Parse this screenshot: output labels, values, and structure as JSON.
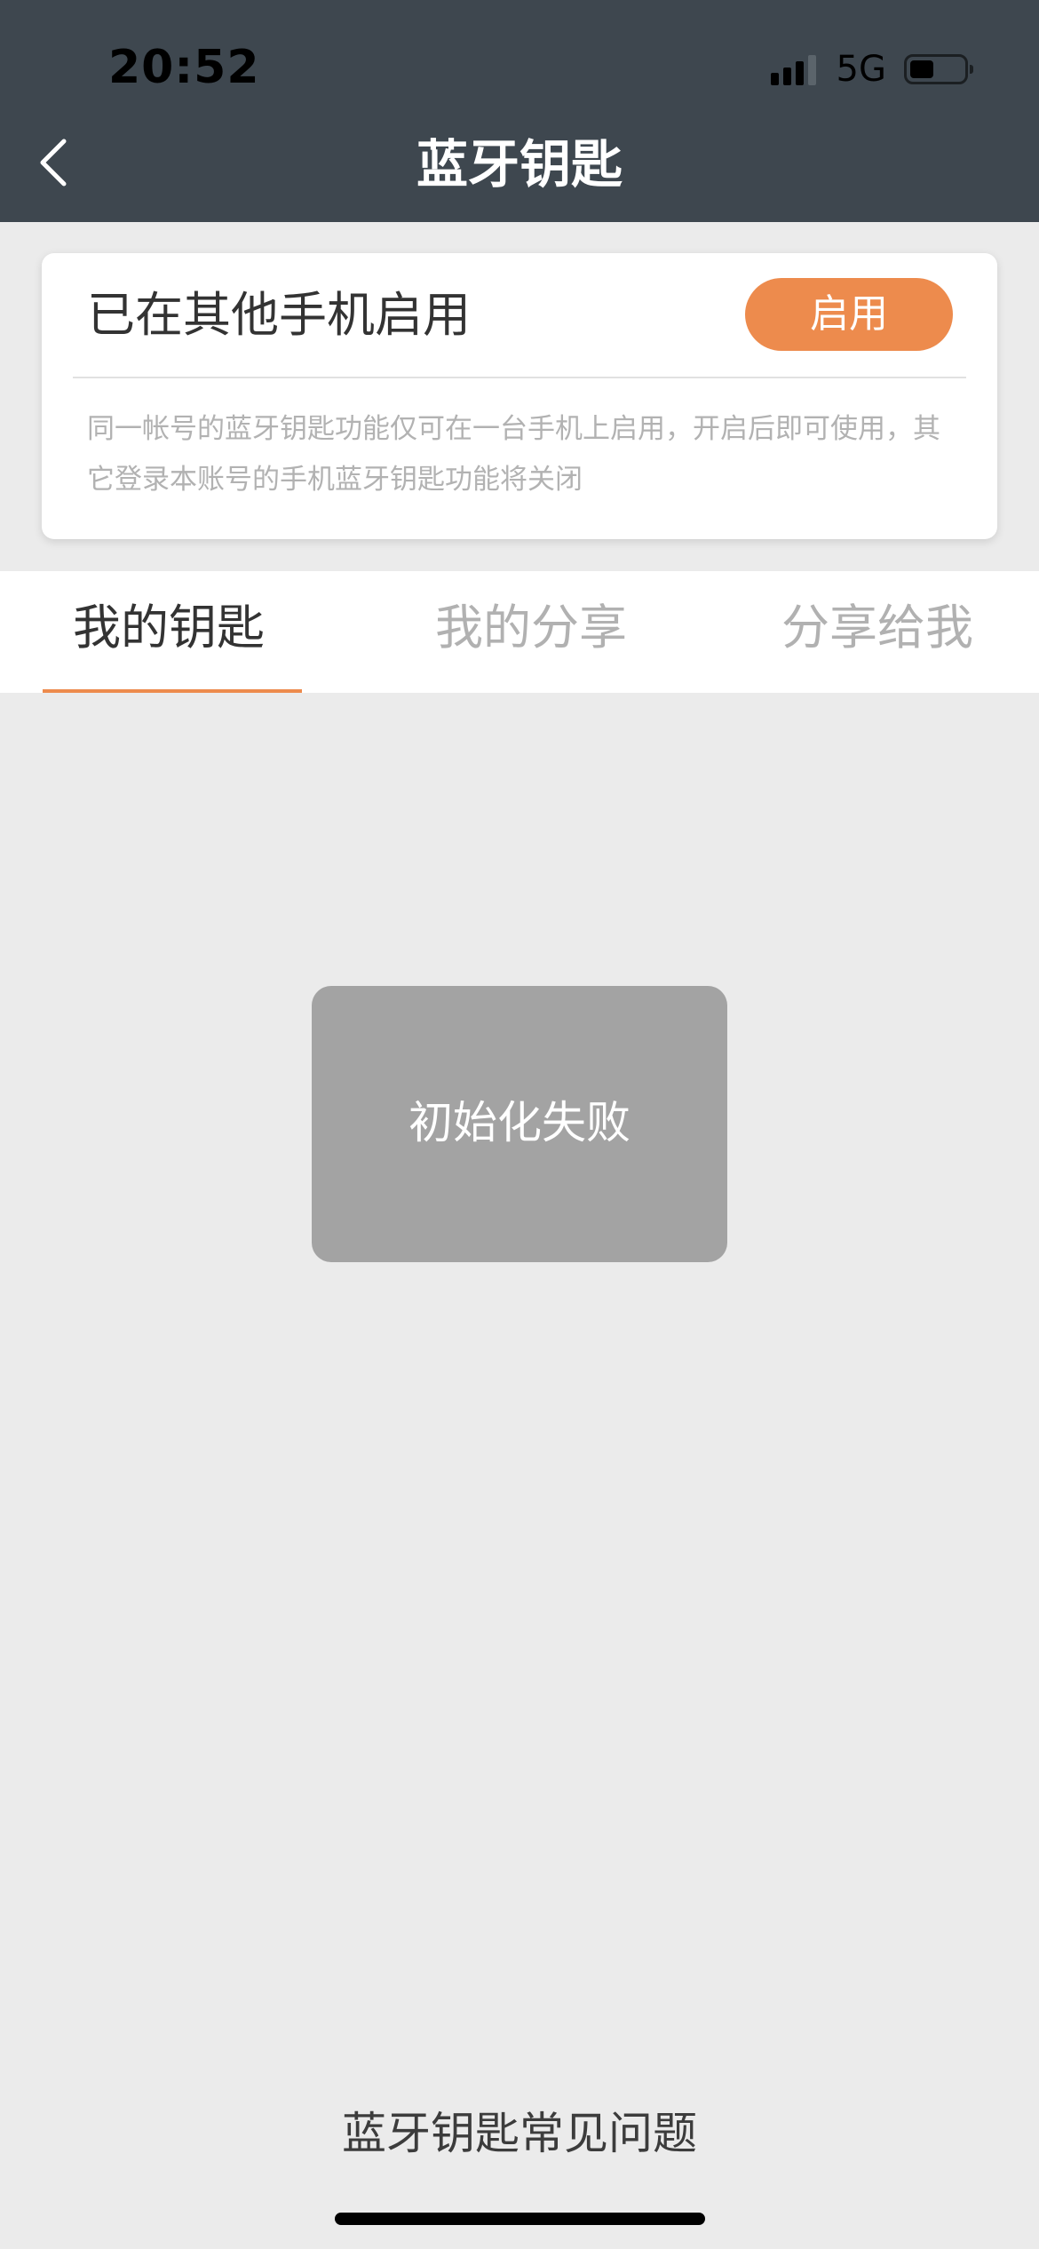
{
  "status_bar": {
    "time": "20:52",
    "network": "5G",
    "signal_bars_active": 3,
    "battery_level": 0.45
  },
  "nav": {
    "title": "蓝牙钥匙",
    "back_icon": "chevron-left-icon"
  },
  "card": {
    "title": "已在其他手机启用",
    "enable_label": "启用",
    "description": "同一帐号的蓝牙钥匙功能仅可在一台手机上启用，开启后即可使用，其它登录本账号的手机蓝牙钥匙功能将关闭"
  },
  "tabs": [
    {
      "label": "我的钥匙",
      "active": true
    },
    {
      "label": "我的分享",
      "active": false
    },
    {
      "label": "分享给我",
      "active": false
    }
  ],
  "toast": {
    "message": "初始化失败"
  },
  "footer": {
    "faq_label": "蓝牙钥匙常见问题"
  },
  "colors": {
    "header_bg": "#3e474f",
    "accent": "#ed8b4d",
    "page_bg": "#ebebeb",
    "toast_bg": "#a3a3a3"
  }
}
